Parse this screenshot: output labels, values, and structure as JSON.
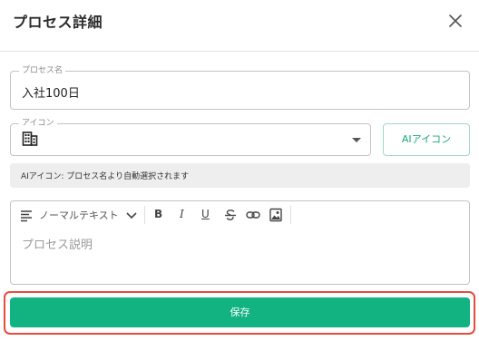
{
  "dialog": {
    "title": "プロセス詳細",
    "close_icon": "close-icon"
  },
  "form": {
    "name_field": {
      "label": "プロセス名",
      "value": "入社100日"
    },
    "icon_field": {
      "label": "アイコン",
      "selected_icon": "building-icon",
      "dropdown_icon": "dropdown-arrow-icon"
    },
    "ai_icon_button": {
      "label": "AIアイコン"
    },
    "hint": "AIアイコン: プロセス名より自動選択されます",
    "description_editor": {
      "toolbar": {
        "block_type": "ノーマルテキスト",
        "bold": "B",
        "italic": "I",
        "underline": "U"
      },
      "placeholder": "プロセス説明"
    },
    "save_button": {
      "label": "保存"
    }
  },
  "colors": {
    "primary": "#12b281",
    "accent_outline": "#9fd9c2",
    "highlight": "#e74c3c"
  }
}
